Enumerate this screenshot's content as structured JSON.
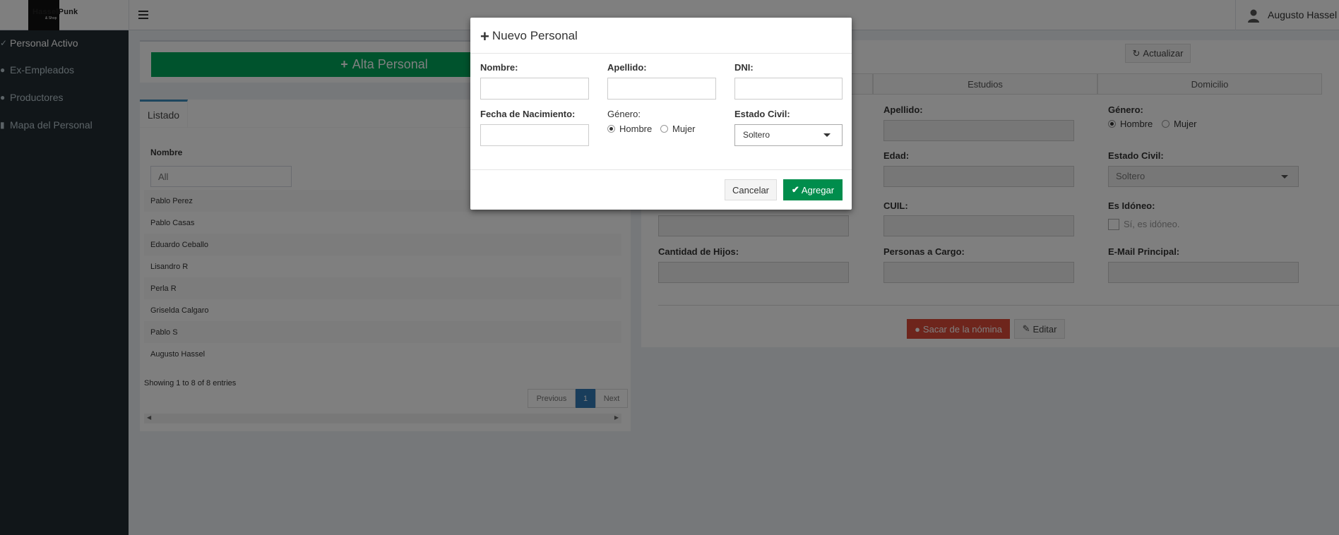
{
  "header": {
    "logo_text": "HasselPunk",
    "logo_sub": "& Shop",
    "user_name": "Augusto Hassel"
  },
  "sidebar": {
    "items": [
      {
        "label": "Personal Activo",
        "icon": "user-icon"
      },
      {
        "label": "Ex-Empleados",
        "icon": "user-times-icon"
      },
      {
        "label": "Productores",
        "icon": "user-icon"
      },
      {
        "label": "Mapa del Personal",
        "icon": "map-icon"
      }
    ]
  },
  "main": {
    "alta_label": "Alta Personal",
    "tab_listado": "Listado",
    "column_nombre": "Nombre",
    "filter_placeholder": "All",
    "rows": [
      "Pablo Perez",
      "Pablo Casas",
      "Eduardo Ceballo",
      "Lisandro R",
      "Perla R",
      "Griselda Calgaro",
      "Pablo S",
      "Augusto Hassel"
    ],
    "showing": "Showing 1 to 8 of 8 entries",
    "pager": {
      "prev": "Previous",
      "current": "1",
      "next": "Next"
    }
  },
  "detail": {
    "actualizar": "Actualizar",
    "tabs": [
      "Estudios",
      "Domicilio"
    ],
    "labels": {
      "apellido": "Apellido:",
      "genero": "Género:",
      "edad": "Edad:",
      "estado_civil": "Estado Civil:",
      "cuil": "CUIL:",
      "es_idoneo": "Es Idóneo:",
      "cantidad_hijos": "Cantidad de Hijos:",
      "personas_cargo": "Personas a Cargo:",
      "email": "E-Mail Principal:"
    },
    "radio_hombre": "Hombre",
    "radio_mujer": "Mujer",
    "estado_civil_value": "Soltero",
    "idoneo_check": "Sí, es idóneo.",
    "sacar": "Sacar de la nómina",
    "editar": "Editar"
  },
  "modal": {
    "title": "Nuevo Personal",
    "labels": {
      "nombre": "Nombre:",
      "apellido": "Apellido:",
      "dni": "DNI:",
      "fecha": "Fecha de Nacimiento:",
      "genero": "Género:",
      "estado_civil": "Estado Civil:"
    },
    "radio_hombre": "Hombre",
    "radio_mujer": "Mujer",
    "estado_civil_value": "Soltero",
    "cancelar": "Cancelar",
    "agregar": "Agregar"
  },
  "colors": {
    "sidebar_bg": "#222d32",
    "success": "#00a65a",
    "danger": "#dd4b39",
    "primary": "#337ab7"
  }
}
